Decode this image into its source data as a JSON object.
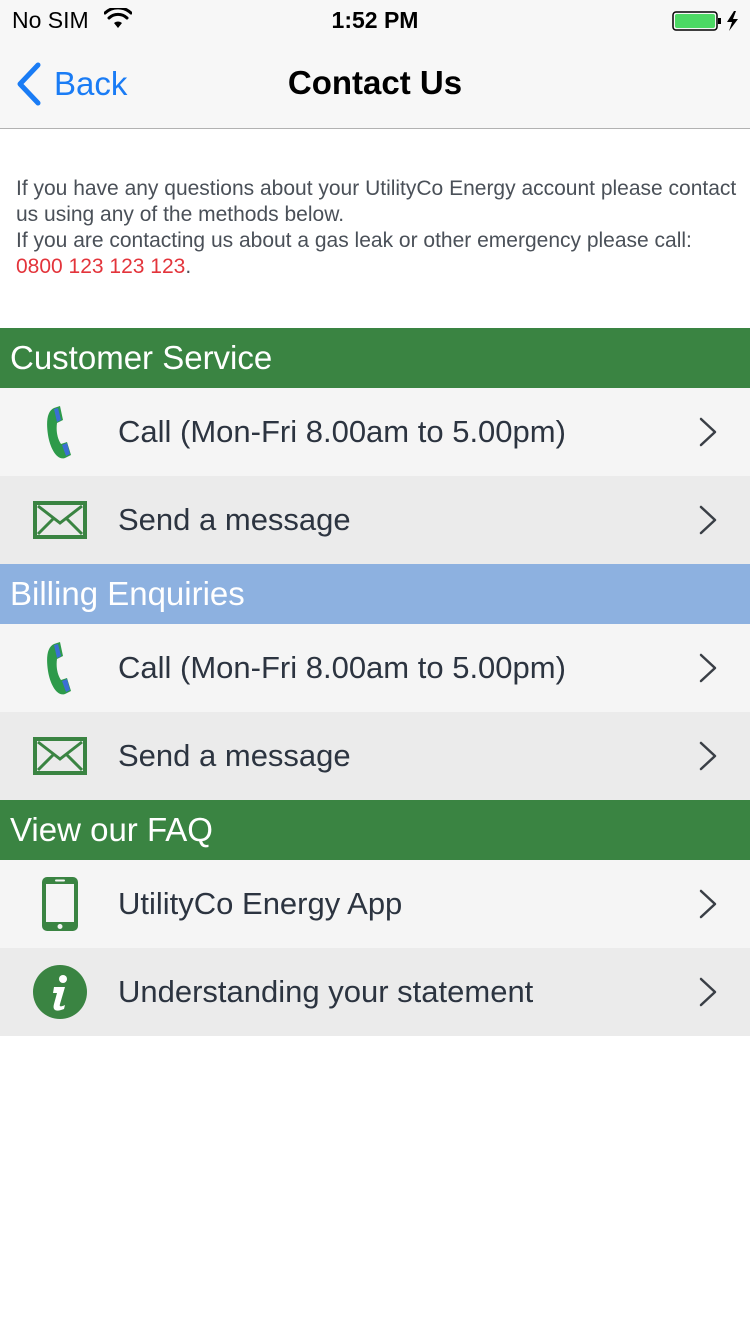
{
  "status_bar": {
    "carrier": "No SIM",
    "time": "1:52 PM",
    "battery_color": "#4cd964"
  },
  "nav": {
    "back_label": "Back",
    "title": "Contact Us"
  },
  "intro": {
    "line1": "If you have any questions about your UtilityCo Energy account please contact us using any of the methods below.",
    "line2_prefix": "If you are contacting us about a gas leak or other emergency please call: ",
    "emergency_phone": "0800 123 123 123",
    "line2_suffix": "."
  },
  "colors": {
    "customer_service_header": "#3a8442",
    "billing_header": "#8db1e0",
    "faq_header": "#3a8442",
    "link_blue": "#1a7cf5",
    "emergency_red": "#e3343b"
  },
  "sections": [
    {
      "title": "Customer Service",
      "items": [
        {
          "label": "Call (Mon-Fri 8.00am to 5.00pm)",
          "icon": "phone-icon"
        },
        {
          "label": "Send a message",
          "icon": "envelope-icon"
        }
      ]
    },
    {
      "title": "Billing Enquiries",
      "items": [
        {
          "label": "Call (Mon-Fri 8.00am to 5.00pm)",
          "icon": "phone-icon"
        },
        {
          "label": "Send a message",
          "icon": "envelope-icon"
        }
      ]
    },
    {
      "title": "View our FAQ",
      "items": [
        {
          "label": "UtilityCo Energy App",
          "icon": "mobile-phone-icon"
        },
        {
          "label": "Understanding your statement",
          "icon": "info-icon"
        }
      ]
    }
  ]
}
